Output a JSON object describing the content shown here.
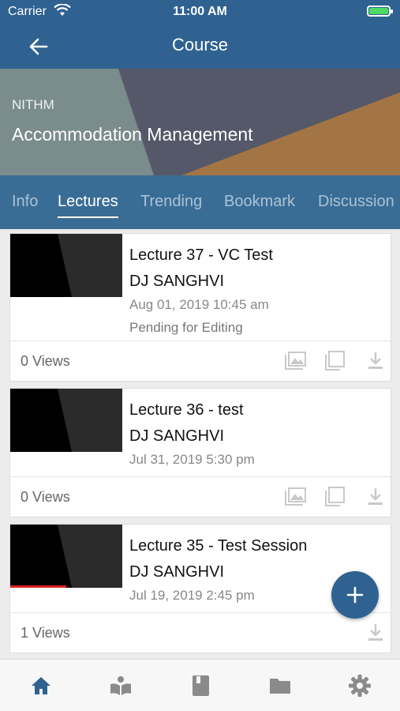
{
  "status_bar": {
    "carrier": "Carrier",
    "time": "11:00 AM"
  },
  "navbar": {
    "title": "Course"
  },
  "banner": {
    "org": "NITHM",
    "course": "Accommodation Management"
  },
  "tabs": [
    "Info",
    "Lectures",
    "Trending",
    "Bookmark",
    "Discussion"
  ],
  "active_tab": "Lectures",
  "lectures": [
    {
      "title": "Lecture 37 - VC Test",
      "author": "DJ SANGHVI",
      "date": "Aug 01, 2019 10:45 am",
      "status": "Pending for Editing",
      "views": "0 Views"
    },
    {
      "title": "Lecture 36 - test",
      "author": "DJ SANGHVI",
      "date": "Jul 31, 2019 5:30 pm",
      "views": "0 Views"
    },
    {
      "title": "Lecture 35 - Test Session",
      "author": "DJ SANGHVI",
      "date": "Jul 19, 2019 2:45 pm",
      "views": "1 Views",
      "watch_progress": 0.5
    }
  ],
  "colors": {
    "primary": "#2f6291",
    "tab_bar": "#3a6d96",
    "battery": "#4cd964",
    "progress": "#e02020"
  },
  "icons": {
    "back": "arrow-left-icon",
    "card_actions": [
      "gallery-icon",
      "copy-icon",
      "download-icon"
    ],
    "fab": "plus-icon",
    "bottom_nav": [
      "home-icon",
      "reader-icon",
      "book-icon",
      "folder-icon",
      "gear-icon"
    ]
  }
}
